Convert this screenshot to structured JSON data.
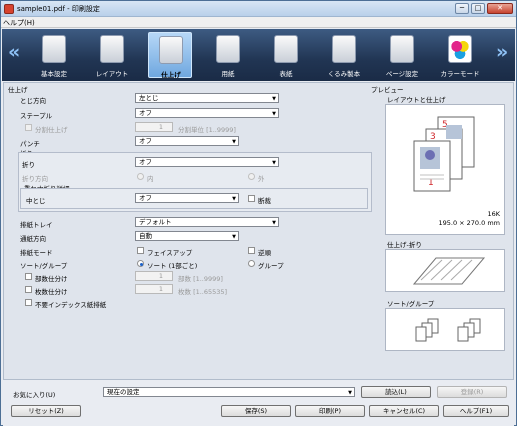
{
  "window": {
    "title": "sample01.pdf - 印刷設定",
    "min": "─",
    "max": "□",
    "close": "✕"
  },
  "menu": {
    "help": "ヘルプ(H)"
  },
  "toolbar": {
    "left_arrow": "«",
    "right_arrow": "»",
    "tabs": [
      {
        "label": "基本設定"
      },
      {
        "label": "レイアウト"
      },
      {
        "label": "仕上げ"
      },
      {
        "label": "用紙"
      },
      {
        "label": "表紙"
      },
      {
        "label": "くるみ製本"
      },
      {
        "label": "ページ設定"
      },
      {
        "label": "カラーモード"
      }
    ]
  },
  "finishing": {
    "section_title": "仕上げ",
    "binding_label": "とじ方向",
    "binding_value": "左とじ",
    "staple_label": "ステープル",
    "staple_value": "オフ",
    "split_label": "分割仕上げ",
    "split_value": "1",
    "split_unit": "分割単位 [1..9999]",
    "punch_label": "パンチ",
    "punch_value": "オフ",
    "fold_group": "折り",
    "fold_label": "折り",
    "fold_value": "オフ",
    "fold_dir_label": "折り方向",
    "fold_in": "内",
    "fold_out": "外",
    "saddle_group": "重ね中折り詳細",
    "saddle_label": "中とじ",
    "saddle_value": "オフ",
    "trim_label": "断裁",
    "tray_label": "排紙トレイ",
    "tray_value": "デフォルト",
    "count_label": "通紙方向",
    "count_value": "自動",
    "output_label": "排紙モード",
    "faceup_label": "フェイスアップ",
    "reverse_label": "逆順",
    "sort_label": "ソート/グループ",
    "sort_option": "ソート (1部ごと)",
    "group_option": "グループ",
    "copies_label": "部数仕分け",
    "copies_value": "1",
    "copies_unit": "部数 [1..9999]",
    "sheets_label": "枚数仕分け",
    "sheets_value": "1",
    "sheets_unit": "枚数 [1..65535]",
    "index_label": "不要インデックス紙排紙"
  },
  "preview": {
    "title": "プレビュー",
    "layout_label": "レイアウトと仕上げ",
    "paper_size": "16K",
    "paper_dims": "195.0 × 270.0 mm",
    "page_numbers": [
      "5",
      "3",
      "1"
    ],
    "fold_label": "仕上げ-折り",
    "sort_label": "ソート/グループ"
  },
  "footer": {
    "favorites_label": "お気に入り(U)",
    "favorites_value": "現在の設定",
    "load_button": "読込(L)",
    "register_button": "登録(R)",
    "reset_button": "リセット(Z)",
    "save_button": "保存(S)",
    "print_button": "印刷(P)",
    "cancel_button": "キャンセル(C)",
    "help_button": "ヘルプ(F1)"
  },
  "colors": {
    "accent": "#1d62c9",
    "page_number": "#d0282c"
  }
}
